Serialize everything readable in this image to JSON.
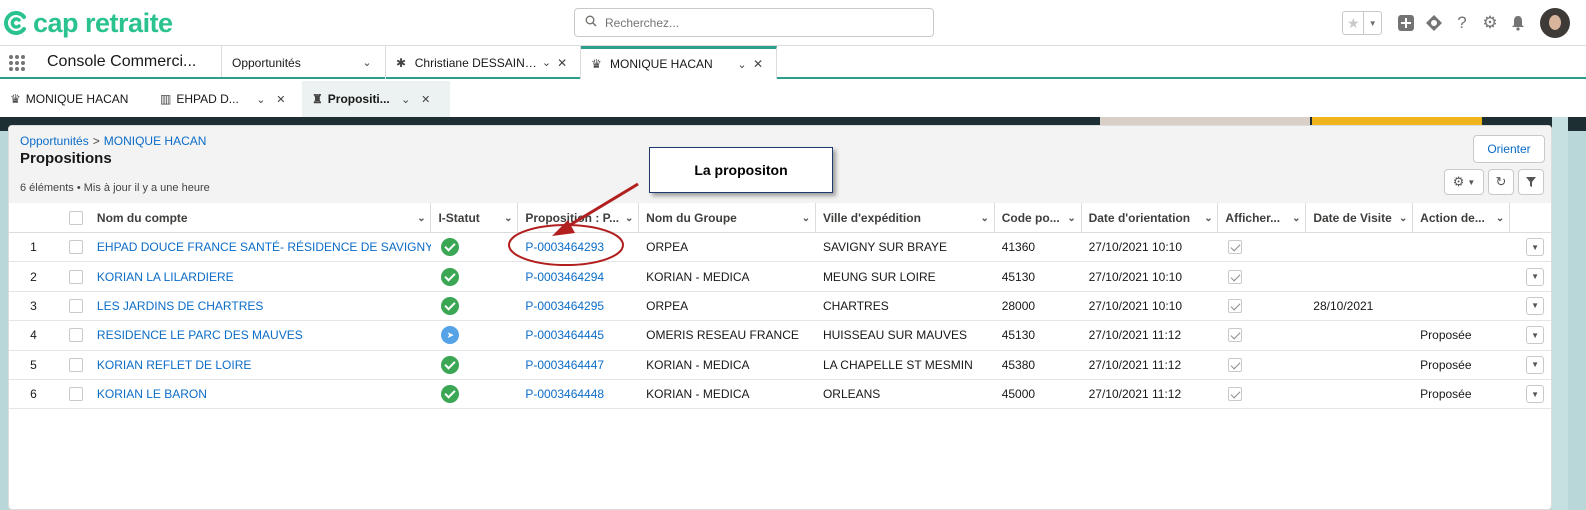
{
  "brand": {
    "logo_text": "cap retraite",
    "color": "#2ac38e"
  },
  "search": {
    "placeholder": "Recherchez..."
  },
  "app": {
    "name": "Console Commerci..."
  },
  "nav_tabs": [
    {
      "label": "Opportunités",
      "icon": ""
    },
    {
      "label": "Christiane DESSAINT...",
      "icon": "person-icon"
    },
    {
      "label": "MONIQUE HACAN",
      "icon": "crown-icon"
    }
  ],
  "sub_tabs": [
    {
      "label": "MONIQUE HACAN"
    },
    {
      "label": "EHPAD D..."
    },
    {
      "label": "Propositi..."
    }
  ],
  "panel": {
    "breadcrumb_parent": "Opportunités",
    "breadcrumb_sep": ">",
    "breadcrumb_current": "MONIQUE HACAN",
    "title": "Propositions",
    "meta": "6 éléments • Mis à jour il y a une heure",
    "orient_button": "Orienter"
  },
  "columns": [
    "Nom du compte",
    "I-Statut",
    "Proposition : P...",
    "Nom du Groupe",
    "Ville d'expédition",
    "Code po...",
    "Date d'orientation",
    "Afficher...",
    "Date de Visite",
    "Action de..."
  ],
  "rows": [
    {
      "num": "1",
      "account": "EHPAD DOUCE FRANCE SANTÉ- RÉSIDENCE DE SAVIGNY",
      "status": "ok",
      "proposition": "P-0003464293",
      "group": "ORPEA",
      "city": "SAVIGNY SUR BRAYE",
      "postal": "41360",
      "date_orient": "27/10/2021 10:10",
      "date_visit": "",
      "action": ""
    },
    {
      "num": "2",
      "account": "KORIAN LA LILARDIERE",
      "status": "ok",
      "proposition": "P-0003464294",
      "group": "KORIAN - MEDICA",
      "city": "MEUNG SUR LOIRE",
      "postal": "45130",
      "date_orient": "27/10/2021 10:10",
      "date_visit": "",
      "action": ""
    },
    {
      "num": "3",
      "account": "LES JARDINS DE CHARTRES",
      "status": "ok",
      "proposition": "P-0003464295",
      "group": "ORPEA",
      "city": "CHARTRES",
      "postal": "28000",
      "date_orient": "27/10/2021 10:10",
      "date_visit": "28/10/2021",
      "action": ""
    },
    {
      "num": "4",
      "account": "RESIDENCE LE PARC DES MAUVES",
      "status": "sent",
      "proposition": "P-0003464445",
      "group": "OMERIS RESEAU FRANCE",
      "city": "HUISSEAU SUR MAUVES",
      "postal": "45130",
      "date_orient": "27/10/2021 11:12",
      "date_visit": "",
      "action": "Proposée"
    },
    {
      "num": "5",
      "account": "KORIAN REFLET DE LOIRE",
      "status": "ok",
      "proposition": "P-0003464447",
      "group": "KORIAN - MEDICA",
      "city": "LA CHAPELLE ST MESMIN",
      "postal": "45380",
      "date_orient": "27/10/2021 11:12",
      "date_visit": "",
      "action": "Proposée"
    },
    {
      "num": "6",
      "account": "KORIAN LE BARON",
      "status": "ok",
      "proposition": "P-0003464448",
      "group": "KORIAN - MEDICA",
      "city": "ORLEANS",
      "postal": "45000",
      "date_orient": "27/10/2021 11:12",
      "date_visit": "",
      "action": "Proposée"
    }
  ],
  "annotation": {
    "text": "La propositon"
  }
}
